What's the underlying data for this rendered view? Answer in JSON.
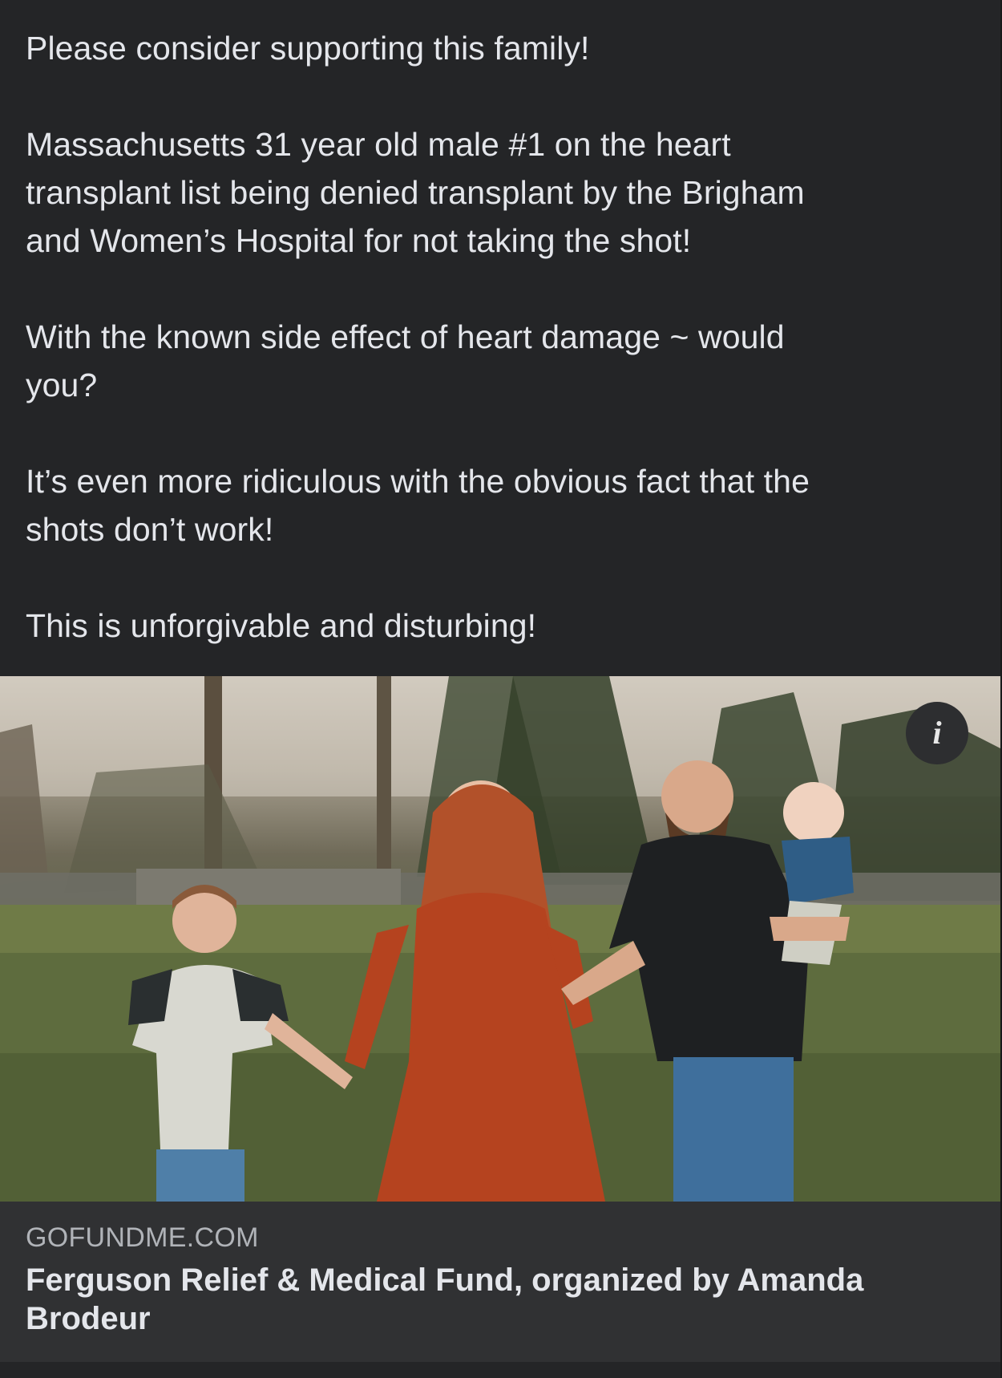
{
  "post": {
    "paragraphs": [
      "Please consider supporting this family!",
      "Massachusetts 31 year old male #1 on the heart\ntransplant list being denied transplant by the Brigham\nand Women’s Hospital for not taking the shot!",
      "With the known side effect of heart damage ~ would\nyou?",
      "It’s even more ridiculous with the obvious fact that the\nshots don’t work!",
      "This is unforgivable and disturbing!"
    ]
  },
  "link_preview": {
    "domain": "GOFUNDME.COM",
    "title": "Ferguson Relief & Medical Fund, organized by Amanda Brodeur",
    "info_icon": "info-icon",
    "image_description_icon": "family-photo"
  },
  "colors": {
    "background": "#242527",
    "text": "#e4e6eb",
    "meta_background": "#303133",
    "domain_text": "#b0b3b8"
  }
}
